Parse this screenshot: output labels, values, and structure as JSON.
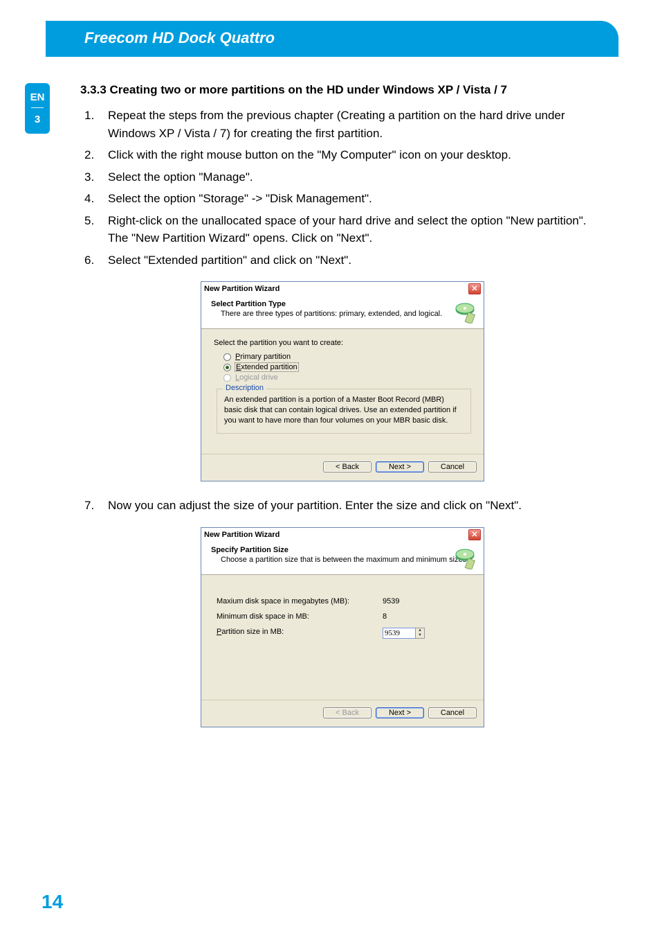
{
  "header": {
    "title": "Freecom HD Dock Quattro"
  },
  "sidebar": {
    "lang": "EN",
    "chapter": "3"
  },
  "section_heading": "3.3.3  Creating two or more partitions on the HD under Windows XP / Vista / 7",
  "steps": [
    "Repeat the steps from the previous chapter (Creating a partition on the hard drive under Windows XP / Vista / 7) for creating the first partition.",
    "Click with the right mouse button on the \"My Computer\" icon on your desktop.",
    "Select the option \"Manage\".",
    "Select the option \"Storage\" -> \"Disk Management\".",
    "Right-click on the unallocated space of your hard drive and select the option \"New partition\". The \"New Partition Wizard\" opens. Click on \"Next\".",
    "Select \"Extended partition\" and click on \"Next\".",
    "Now you can adjust the size of your partition. Enter the size and click on \"Next\"."
  ],
  "dialog1": {
    "window_title": "New Partition Wizard",
    "header_title": "Select Partition Type",
    "header_sub": "There are three types of partitions: primary, extended, and logical.",
    "prompt": "Select the partition you want to create:",
    "options": {
      "primary": "Primary partition",
      "extended": "Extended partition",
      "logical": "Logical drive"
    },
    "desc_legend": "Description",
    "desc_text": "An extended partition is a portion of a Master Boot Record (MBR) basic disk that can contain logical drives. Use an extended partition if you want to have more than four volumes on your MBR basic disk.",
    "buttons": {
      "back": "< Back",
      "next": "Next >",
      "cancel": "Cancel"
    }
  },
  "dialog2": {
    "window_title": "New Partition Wizard",
    "header_title": "Specify Partition Size",
    "header_sub": "Choose a partition size that is between the maximum and minimum sizes.",
    "rows": {
      "max_label": "Maxium disk space in megabytes (MB):",
      "max_value": "9539",
      "min_label": "Minimum disk space in MB:",
      "min_value": "8",
      "size_label": "Partition size in MB:",
      "size_value": "9539"
    },
    "buttons": {
      "back": "< Back",
      "next": "Next >",
      "cancel": "Cancel"
    }
  },
  "page_number": "14"
}
